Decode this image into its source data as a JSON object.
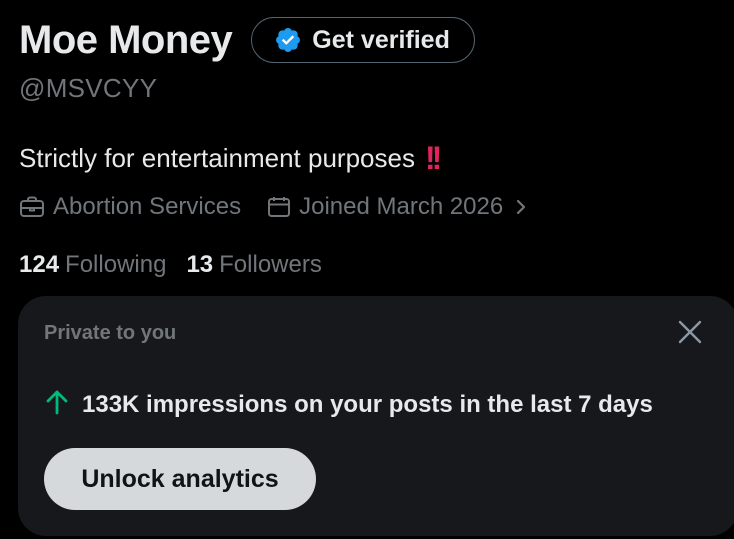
{
  "profile": {
    "display_name": "Moe Money",
    "verify_button_label": "Get verified",
    "handle": "@MSVCYY",
    "bio_text": "Strictly for entertainment purposes",
    "bio_emoji": "!!",
    "category": "Abortion Services",
    "joined": "Joined March 2026",
    "following_count": "124",
    "following_label": "Following",
    "followers_count": "13",
    "followers_label": "Followers"
  },
  "analytics_card": {
    "header": "Private to you",
    "stat_text": "133K impressions on your posts in the last 7 days",
    "unlock_button_label": "Unlock analytics"
  },
  "icons": {
    "verified": "verified-badge-icon",
    "category": "briefcase-icon",
    "joined": "calendar-icon",
    "chevron": "chevron-right-icon",
    "close": "close-icon",
    "trend": "arrow-up-icon"
  },
  "colors": {
    "background": "#000000",
    "card": "#16181c",
    "accent_blue": "#1d9bf0",
    "trend_green": "#00ba7c",
    "emoji_red": "#e0245e",
    "muted_text": "#71767b",
    "primary_text": "#e7e9ea"
  }
}
